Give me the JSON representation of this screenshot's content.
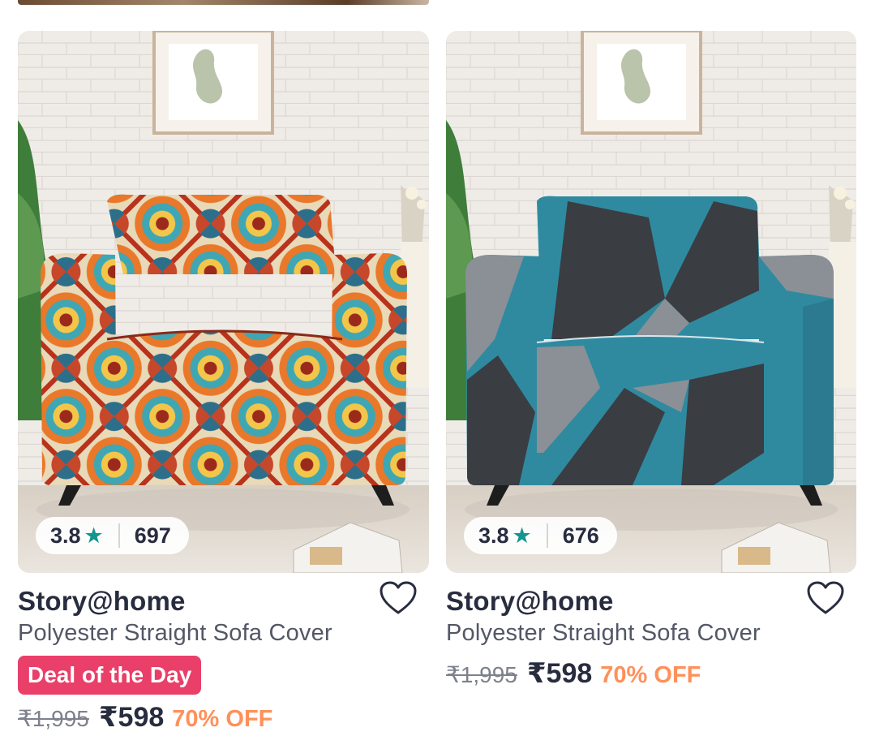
{
  "colors": {
    "deal_badge": "#e93f69",
    "discount": "#ff905a",
    "star": "#14958f",
    "text_primary": "#282c3f",
    "text_secondary": "#535766"
  },
  "icons": {
    "rating": "star-icon",
    "wishlist": "heart-outline-icon"
  },
  "products": [
    {
      "image_alt": "Sofa with orange and blue mandala print cover",
      "rating": "3.8",
      "star_glyph": "★",
      "rating_count": "697",
      "brand": "Story@home",
      "title": "Polyester Straight Sofa Cover",
      "badge": "Deal of the Day",
      "mrp": "₹1,995",
      "price": "₹598",
      "discount": "70% OFF"
    },
    {
      "image_alt": "Sofa with teal, grey and black geometric print cover",
      "rating": "3.8",
      "star_glyph": "★",
      "rating_count": "676",
      "brand": "Story@home",
      "title": "Polyester Straight Sofa Cover",
      "mrp": "₹1,995",
      "price": "₹598",
      "discount": "70% OFF"
    }
  ]
}
